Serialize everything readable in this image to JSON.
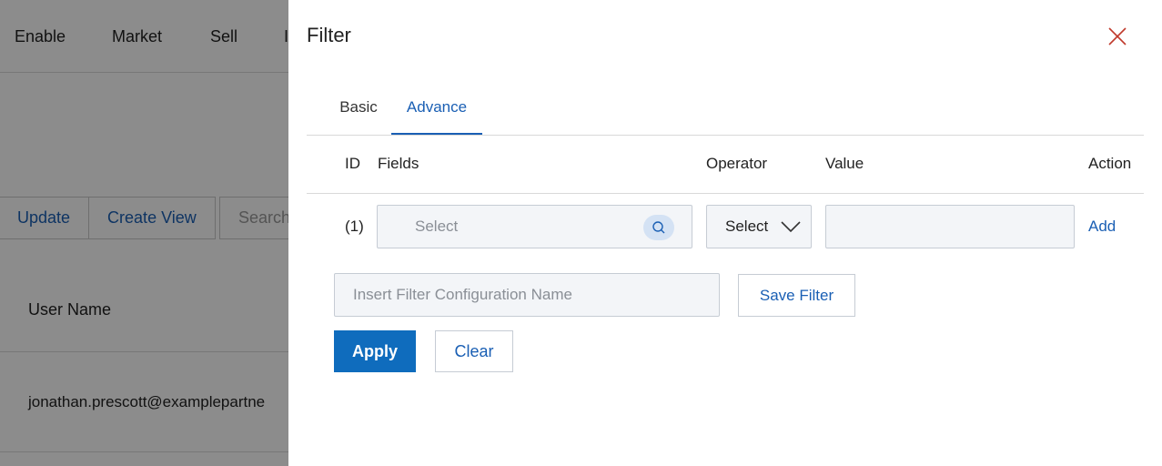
{
  "background": {
    "nav_items": [
      "Enable",
      "Market",
      "Sell",
      "I"
    ],
    "toolbar": {
      "update_label": "Update",
      "create_view_label": "Create View",
      "search_placeholder": "Search"
    },
    "table": {
      "header_user_name": "User Name",
      "row_email": "jonathan.prescott@examplepartne"
    }
  },
  "drawer": {
    "title": "Filter",
    "tabs": [
      {
        "label": "Basic",
        "active": false
      },
      {
        "label": "Advance",
        "active": true
      }
    ],
    "columns": {
      "id": "ID",
      "fields": "Fields",
      "operator": "Operator",
      "value": "Value",
      "action": "Action"
    },
    "row": {
      "id": "(1)",
      "fields_placeholder": "Select",
      "operator_value": "Select",
      "value": "",
      "action_label": "Add"
    },
    "config_name_placeholder": "Insert Filter Configuration Name",
    "save_filter_label": "Save Filter",
    "apply_label": "Apply",
    "clear_label": "Clear"
  },
  "icons": {
    "close": "close-icon",
    "search": "search-icon",
    "chevron": "chevron-down-icon"
  },
  "colors": {
    "accent": "#1a5fb4",
    "primary_button": "#0f6cbd",
    "close_icon": "#c0392b",
    "input_bg": "#f3f5f8",
    "overlay": "rgba(0,0,0,0.45)"
  }
}
